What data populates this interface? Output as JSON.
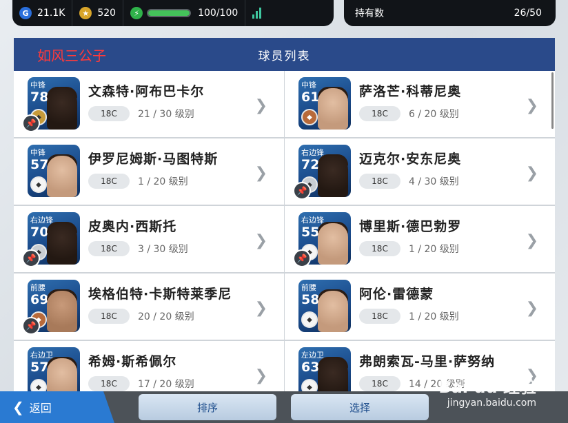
{
  "topbar": {
    "gp_value": "21.1K",
    "coins_value": "520",
    "energy_text": "100/100",
    "energy_percent": 100,
    "holdings_label": "持有数",
    "holdings_value": "26/50"
  },
  "header": {
    "title": "球员列表",
    "overlay_name": "如风三公子"
  },
  "players": [
    {
      "pos": "中锋",
      "rating": "78",
      "name": "文森特·阿布巴卡尔",
      "class": "18C",
      "level": "21 / 30 级别",
      "badge": "gold",
      "face": "dark",
      "pinned": true
    },
    {
      "pos": "中锋",
      "rating": "61",
      "name": "萨洛芒·科蒂尼奥",
      "class": "18C",
      "level": "6 / 20 级别",
      "badge": "bronze",
      "face": "light",
      "pinned": false
    },
    {
      "pos": "中锋",
      "rating": "57",
      "name": "伊罗尼姆斯·马图特斯",
      "class": "18C",
      "level": "1 / 20 级别",
      "badge": "white",
      "face": "light",
      "pinned": false
    },
    {
      "pos": "右边锋",
      "rating": "72",
      "name": "迈克尔·安东尼奥",
      "class": "18C",
      "level": "4 / 30 级别",
      "badge": "silver",
      "face": "dark",
      "pinned": true
    },
    {
      "pos": "右边锋",
      "rating": "70",
      "name": "皮奥内·西斯托",
      "class": "18C",
      "level": "3 / 30 级别",
      "badge": "silver",
      "face": "dark",
      "pinned": true
    },
    {
      "pos": "右边锋",
      "rating": "55",
      "name": "博里斯·德巴勃罗",
      "class": "18C",
      "level": "1 / 20 级别",
      "badge": "white",
      "face": "light",
      "pinned": true
    },
    {
      "pos": "前腰",
      "rating": "69",
      "name": "埃格伯特·卡斯特莱季尼",
      "class": "18C",
      "level": "20 / 20 级别",
      "badge": "bronze",
      "face": "mid",
      "pinned": true
    },
    {
      "pos": "前腰",
      "rating": "58",
      "name": "阿伦·雷德蒙",
      "class": "18C",
      "level": "1 / 20 级别",
      "badge": "white",
      "face": "light",
      "pinned": false
    },
    {
      "pos": "右边卫",
      "rating": "57",
      "name": "希姆·斯希佩尔",
      "class": "18C",
      "level": "17 / 20 级别",
      "badge": "white",
      "face": "light",
      "pinned": false
    },
    {
      "pos": "左边卫",
      "rating": "63",
      "name": "弗朗索瓦-马里·萨努纳",
      "class": "18C",
      "level": "14 / 20 级别",
      "badge": "white",
      "face": "dark",
      "pinned": false
    }
  ],
  "bottom": {
    "back_label": "返回",
    "sort_label": "排序",
    "select_label": "选择"
  },
  "watermark": {
    "logo": "Bai du 经验",
    "url": "jingyan.baidu.com"
  }
}
